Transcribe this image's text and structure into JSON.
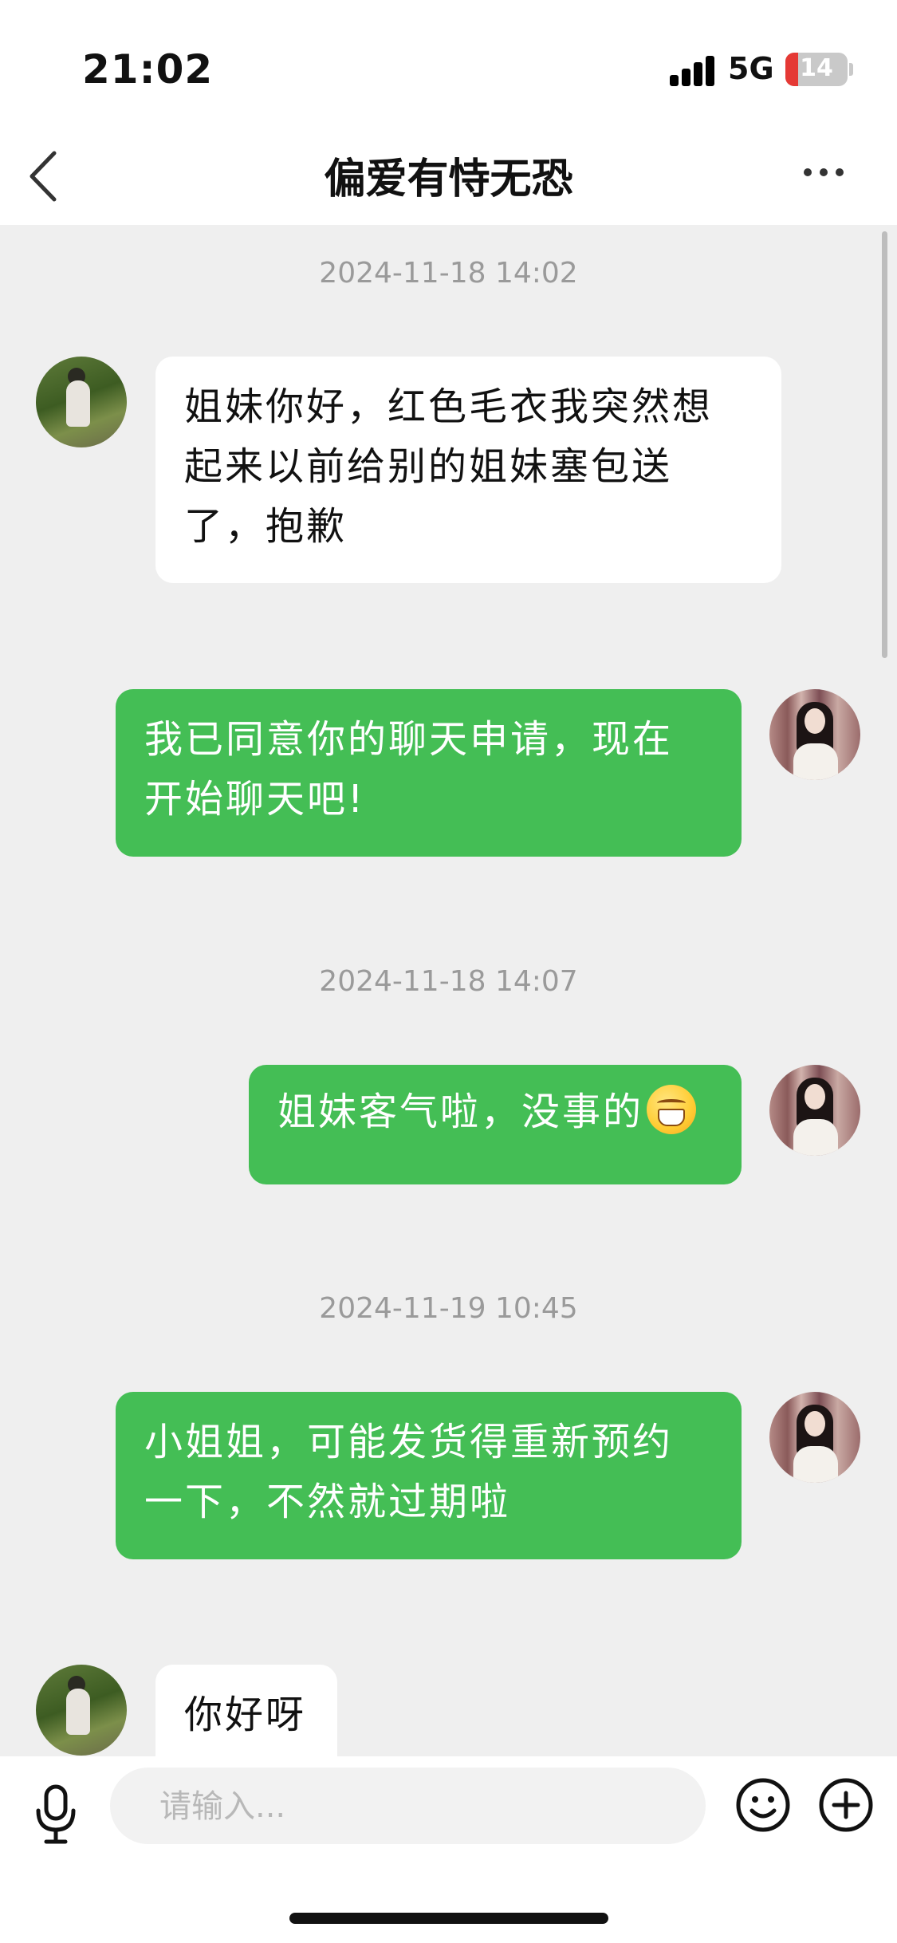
{
  "status_bar": {
    "time": "21:02",
    "network": "5G",
    "battery": "14",
    "battery_color": "#e53935"
  },
  "nav": {
    "back_icon": "chevron-left-icon",
    "title": "偏爱有恃无恐",
    "more_icon": "more-horizontal-icon"
  },
  "messages": [
    {
      "type": "timestamp",
      "text": "2024-11-18 14:02"
    },
    {
      "type": "incoming",
      "text": "姐妹你好，红色毛衣我突然想起来以前给别的姐妹塞包送了，抱歉"
    },
    {
      "type": "outgoing",
      "text": "我已同意你的聊天申请，现在开始聊天吧!"
    },
    {
      "type": "timestamp",
      "text": "2024-11-18 14:07"
    },
    {
      "type": "outgoing",
      "text": "姐妹客气啦，没事的",
      "emoji": "grinning-face-emoji"
    },
    {
      "type": "timestamp",
      "text": "2024-11-19 10:45"
    },
    {
      "type": "outgoing",
      "text": "小姐姐，可能发货得重新预约一下，不然就过期啦"
    },
    {
      "type": "incoming",
      "text": "你好呀"
    }
  ],
  "input_bar": {
    "voice_icon": "microphone-icon",
    "placeholder": "请输入...",
    "emoji_icon": "smiley-icon",
    "plus_icon": "plus-circle-icon"
  },
  "colors": {
    "outgoing_bubble": "#44be55",
    "incoming_bubble": "#ffffff",
    "chat_background": "#efefef"
  }
}
